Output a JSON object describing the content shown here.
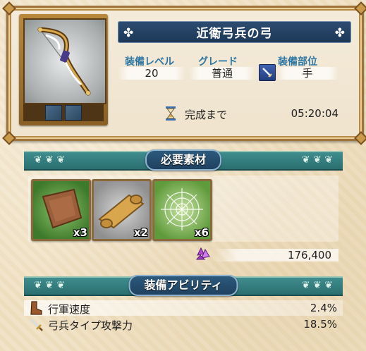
{
  "item": {
    "name": "近衛弓兵の弓",
    "stats": [
      {
        "label": "装備レベル",
        "value": "20"
      },
      {
        "label": "グレード",
        "value": "普通"
      },
      {
        "label": "装備部位",
        "value": "手"
      }
    ],
    "completion_label": "完成まで",
    "completion_time": "05:20:04"
  },
  "materials_section": {
    "title": "必要素材",
    "items": [
      {
        "icon": "leather-icon",
        "quantity": "x3"
      },
      {
        "icon": "scroll-icon",
        "quantity": "x2"
      },
      {
        "icon": "spiderweb-icon",
        "quantity": "x6"
      }
    ],
    "cost": {
      "icon": "crystal-icon",
      "amount": "176,400"
    }
  },
  "abilities_section": {
    "title": "装備アビリティ",
    "items": [
      {
        "icon": "boot-icon",
        "name": "行軍速度",
        "value": "2.4%"
      },
      {
        "icon": "sword-icon",
        "name": "弓兵タイプ攻撃力",
        "value": "18.5%"
      }
    ]
  },
  "colors": {
    "banner_blue": "#1d3756",
    "label_blue": "#2c76a4",
    "section_teal": "#2b6e70",
    "frame_gold": "#a0733a"
  }
}
